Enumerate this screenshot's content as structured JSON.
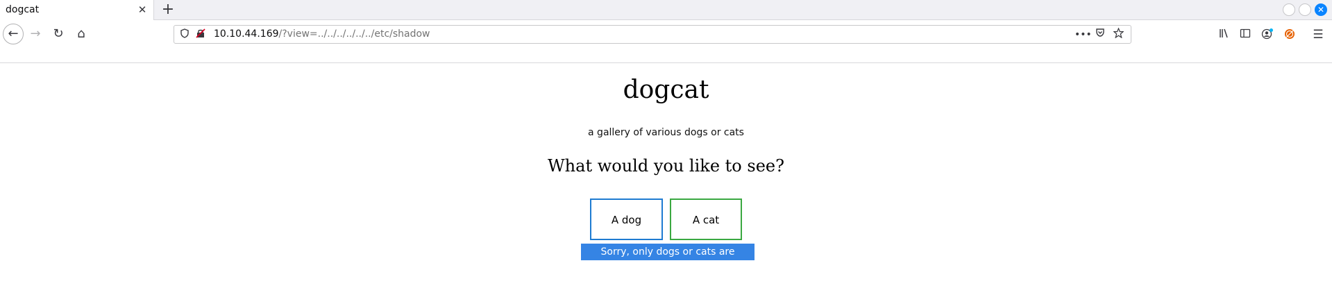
{
  "tab": {
    "title": "dogcat",
    "close_glyph": "✕",
    "newtab_glyph": "+"
  },
  "window": {
    "close_glyph": "✕"
  },
  "toolbar": {
    "back_glyph": "←",
    "forward_glyph": "→",
    "reload_glyph": "↻",
    "home_glyph": "⌂",
    "url_host": "10.10.44.169",
    "url_path": "/?view=../../../../../../etc/shadow",
    "more_glyph": "•••",
    "menu_glyph": "☰"
  },
  "page": {
    "site_title": "dogcat",
    "subtitle": "a gallery of various dogs or cats",
    "question": "What would you like to see?",
    "dog_button": "A dog",
    "cat_button": "A cat",
    "message": "Sorry, only dogs or cats are allowed."
  },
  "colors": {
    "accent": "#0a84ff",
    "dog_border": "#1e7bd1",
    "cat_border": "#3aa841",
    "message_bg": "#3584e4"
  }
}
